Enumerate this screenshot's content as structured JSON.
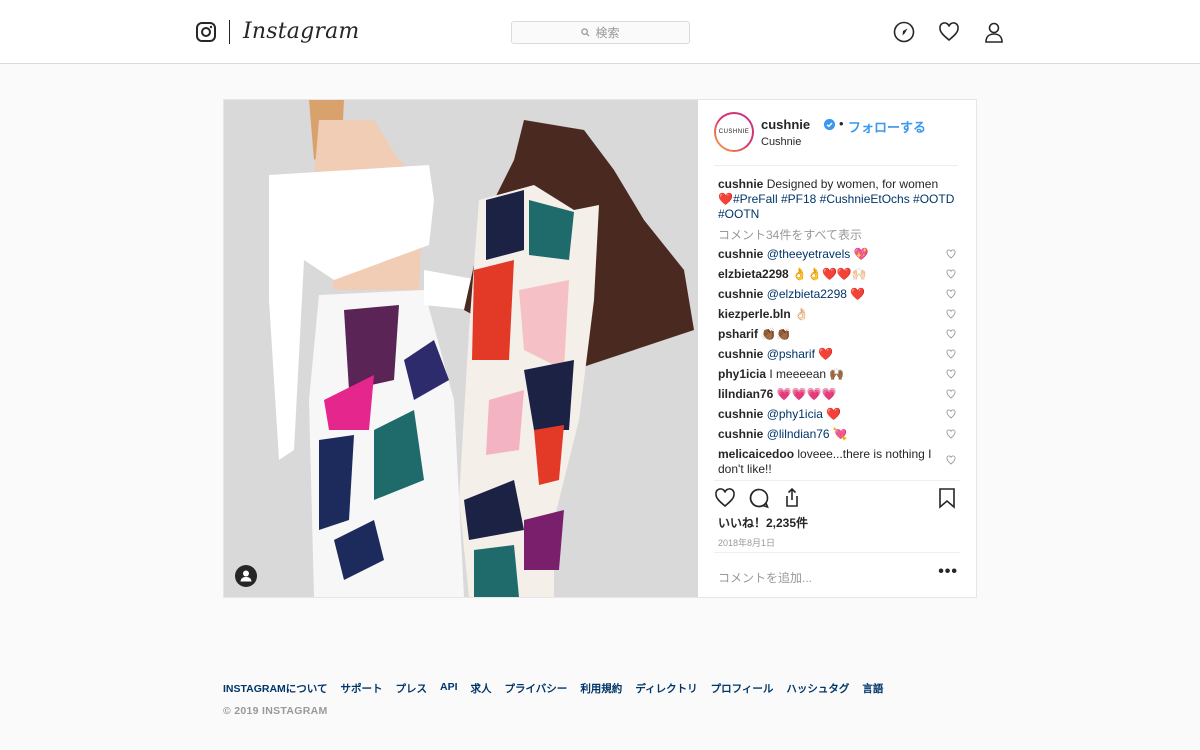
{
  "nav": {
    "wordmark": "Instagram",
    "search_placeholder": "検索"
  },
  "post": {
    "username": "cushnie",
    "follow_label": "フォローする",
    "dot": "•",
    "subtitle": "Cushnie",
    "avatar_text": "CUSHNIE",
    "caption": {
      "user": "cushnie",
      "text": "Designed by women, for women",
      "heart": "❤️",
      "hashtags": "#PreFall #PF18 #CushnieEtOchs #OOTD #OOTN"
    },
    "view_all": "コメント34件をすべて表示",
    "comments": [
      {
        "user": "cushnie",
        "mention": "@theeyetravels",
        "text": " 💖"
      },
      {
        "user": "elzbieta2298",
        "mention": "",
        "text": "👌👌❤️❤️🙌🏻"
      },
      {
        "user": "cushnie",
        "mention": "@elzbieta2298",
        "text": " ❤️"
      },
      {
        "user": "kiezperle.bln",
        "mention": "",
        "text": "👌🏻"
      },
      {
        "user": "psharif",
        "mention": "",
        "text": "👏🏾👏🏾"
      },
      {
        "user": "cushnie",
        "mention": "@psharif",
        "text": " ❤️"
      },
      {
        "user": "phy1icia",
        "mention": "",
        "text": "I meeeean 🙌🏾"
      },
      {
        "user": "lilndian76",
        "mention": "",
        "text": "💗💗💗💗"
      },
      {
        "user": "cushnie",
        "mention": "@phy1icia",
        "text": " ❤️"
      },
      {
        "user": "cushnie",
        "mention": "@lilndian76",
        "text": " 💘"
      },
      {
        "user": "melicaicedoo",
        "mention": "",
        "text": "loveee...there is nothing I don't like!!"
      }
    ],
    "likes": "いいね！2,235件",
    "date": "2018年8月1日",
    "add_comment_placeholder": "コメントを追加...",
    "more": "•••"
  },
  "footer": {
    "links": [
      "INSTAGRAMについて",
      "サポート",
      "プレス",
      "API",
      "求人",
      "プライバシー",
      "利用規約",
      "ディレクトリ",
      "プロフィール",
      "ハッシュタグ",
      "言語"
    ],
    "copyright": "© 2019 INSTAGRAM"
  },
  "colors": {
    "link_blue": "#3897f0",
    "hashtag_navy": "#003569",
    "muted": "#999999",
    "border": "#dbdbdb"
  },
  "icons": [
    "instagram-camera-icon",
    "search-icon",
    "compass-icon",
    "heart-icon",
    "user-icon",
    "verified-badge-icon",
    "comment-heart-icon",
    "like-icon",
    "comment-icon",
    "share-icon",
    "bookmark-icon",
    "tag-user-icon",
    "more-options-icon"
  ]
}
